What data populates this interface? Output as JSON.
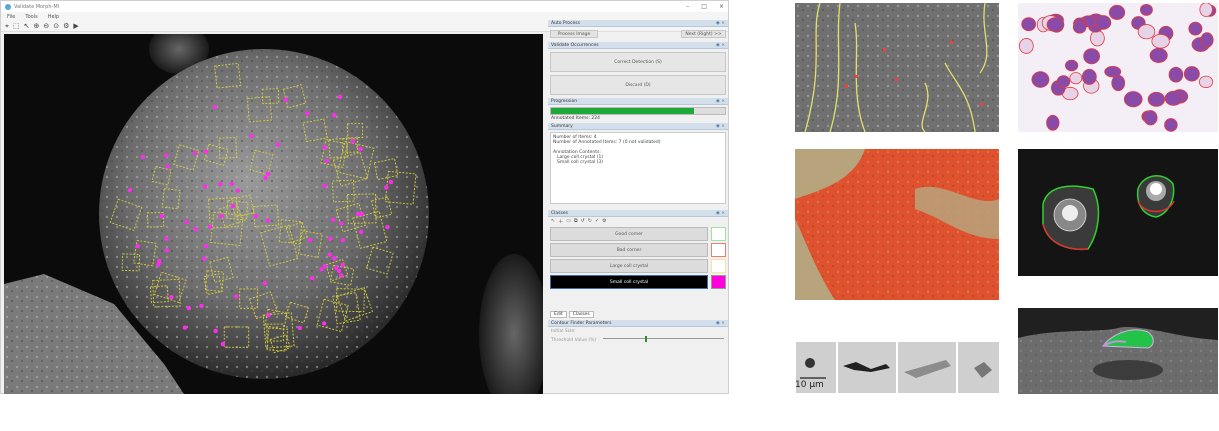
{
  "app": {
    "title": "Validate Morph-Ml",
    "window_controls": [
      "–",
      "□",
      "×"
    ],
    "menu": [
      "File",
      "Tools",
      "Help"
    ],
    "toolbar_icons": [
      "select-tool-icon",
      "rect-tool-icon",
      "pointer-icon",
      "zoom-in-icon",
      "zoom-out-icon",
      "zoom-fit-icon",
      "settings-icon",
      "run-icon"
    ]
  },
  "panels": {
    "auto_process": {
      "title": "Auto Process",
      "button_left": "Process Image",
      "button_right": "Next (Right) >>"
    },
    "validate": {
      "title": "Validate Occurrences",
      "button_top": "Correct Detection (S)",
      "button_bottom": "Discard (D)"
    },
    "progression": {
      "title": "Progression",
      "progress": 0.82,
      "annotated_text": "Annotated Items: 224"
    },
    "summary": {
      "title": "Summary",
      "lines": [
        "Number of Items: 4",
        "Number of Annotated Items: 7 (0 not validated)",
        "",
        "Annotation Contents:",
        "  Large coll crystal (1)",
        "  Small coll crystal (3)"
      ]
    },
    "classes": {
      "title": "Classes",
      "items": [
        {
          "label": "Good corner",
          "color": "#9ee39e",
          "selected": false
        },
        {
          "label": "Bad corner",
          "color": "#e87f7f",
          "selected": false
        },
        {
          "label": "Large coll crystal",
          "color": "#f3e7a2",
          "selected": false
        },
        {
          "label": "Small coll crystal",
          "color": "#ff00dd",
          "selected": true
        }
      ]
    },
    "bottom_tabs": [
      "Edit",
      "Classes"
    ],
    "contour": {
      "title": "Contour Finder Parameters",
      "row1": "Initial Size:",
      "row2": "Threshold Value (%)",
      "slider_value": 0.35
    }
  },
  "gallery": {
    "scale_label": "10 µm"
  }
}
